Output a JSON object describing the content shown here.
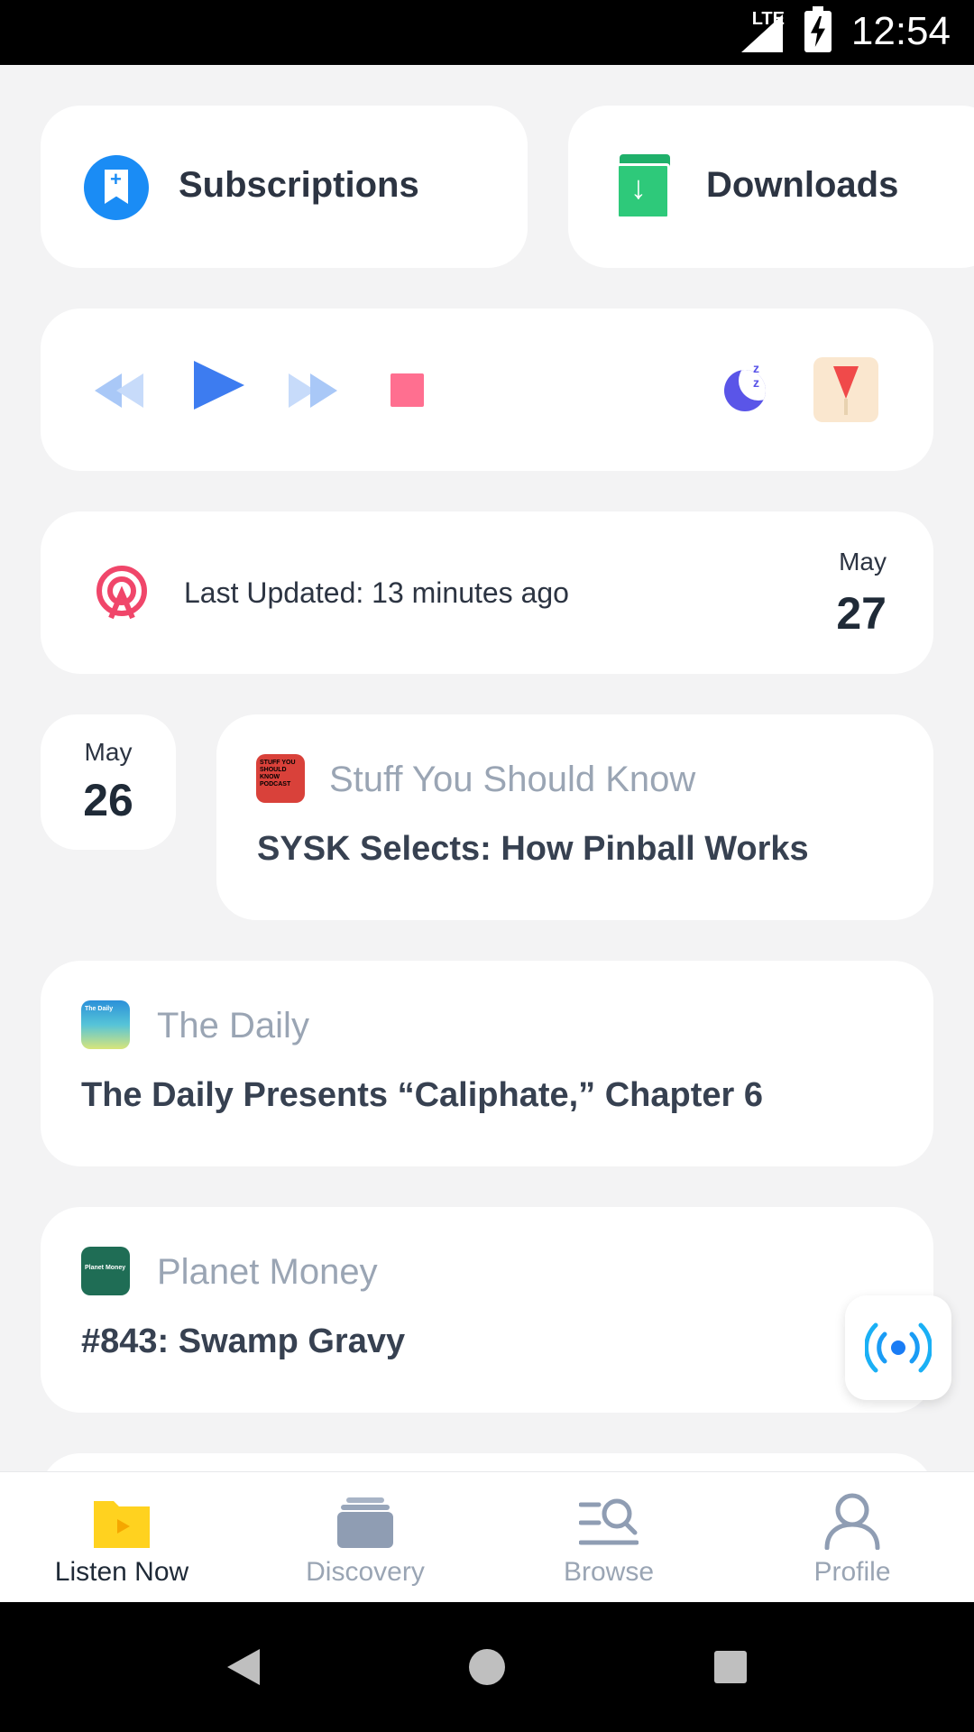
{
  "status_bar": {
    "network": "LTE",
    "time": "12:54"
  },
  "shortcuts": {
    "subscriptions_label": "Subscriptions",
    "downloads_label": "Downloads"
  },
  "player": {
    "controls": [
      "rewind-icon",
      "play-icon",
      "fast-forward-icon",
      "stop-icon",
      "sleep-timer-icon"
    ]
  },
  "update": {
    "text": "Last Updated: 13 minutes ago",
    "month": "May",
    "day": "27"
  },
  "date_divider": {
    "month": "May",
    "day": "26"
  },
  "episodes": [
    {
      "podcast": "Stuff You Should Know",
      "title": "SYSK Selects: How Pinball Works",
      "thumb_text": "STUFF YOU SHOULD KNOW PODCAST"
    },
    {
      "podcast": "The Daily",
      "title": "The Daily Presents “Caliphate,” Chapter 6",
      "thumb_text": "The Daily"
    },
    {
      "podcast": "Planet Money",
      "title": "#843: Swamp Gravy",
      "thumb_text": "Planet Money"
    }
  ],
  "bottom_nav": {
    "items": [
      {
        "label": "Listen Now",
        "icon": "folder-play-icon",
        "active": true
      },
      {
        "label": "Discovery",
        "icon": "cards-stack-icon",
        "active": false
      },
      {
        "label": "Browse",
        "icon": "search-list-icon",
        "active": false
      },
      {
        "label": "Profile",
        "icon": "person-icon",
        "active": false
      }
    ]
  },
  "colors": {
    "accent_blue": "#1a8cf5",
    "play_blue": "#3d7cf0",
    "stop_pink": "#ff6f90",
    "active_folder": "#ffd21f",
    "muted_text": "#9aa5b4"
  }
}
